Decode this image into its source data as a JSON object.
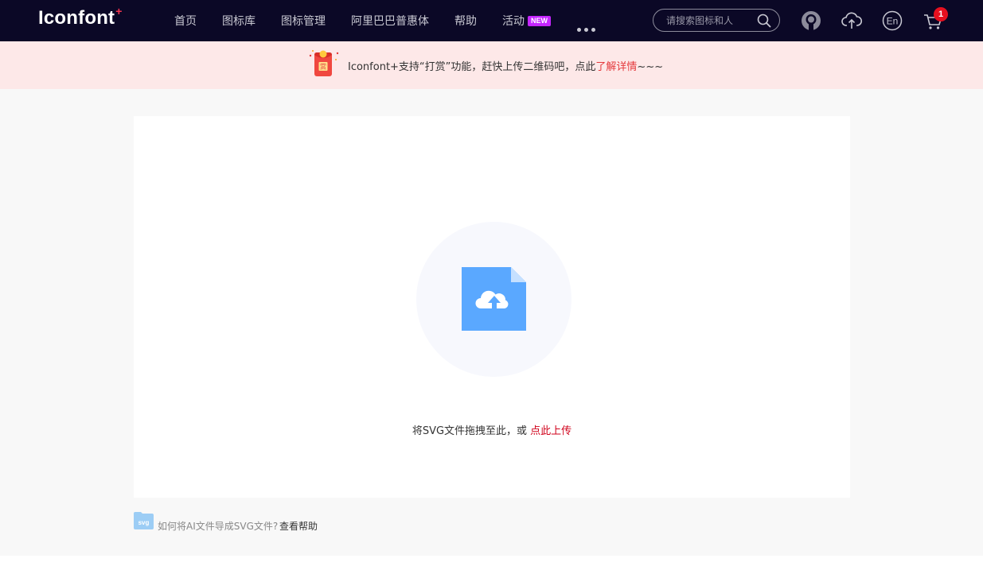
{
  "header": {
    "logo_text": "Iconfont",
    "logo_plus": "+",
    "nav": [
      "首页",
      "图标库",
      "图标管理",
      "阿里巴巴普惠体",
      "帮助",
      "活动"
    ],
    "new_badge": "NEW",
    "search_placeholder": "请搜索图标和人",
    "cart_count": "1",
    "icons": [
      "github-icon",
      "upload-cloud-icon",
      "language-en-icon",
      "cart-icon"
    ]
  },
  "notice": {
    "text": "Iconfont+支持“打赏”功能，赶快上传二维码吧，点此",
    "link": "了解详情",
    "suffix": "~~~"
  },
  "upload": {
    "prompt": "将SVG文件拖拽至此，或 ",
    "link": "点此上传"
  },
  "help": {
    "badge": "svg",
    "question": "如何将AI文件导成SVG文件?",
    "link": "查看帮助"
  },
  "colors": {
    "nav_bg": "#0b0826",
    "notice_bg": "#fde8e8",
    "accent_red": "#e4393c",
    "file_blue": "#5aa8ff",
    "new_badge": "#c526ff"
  }
}
